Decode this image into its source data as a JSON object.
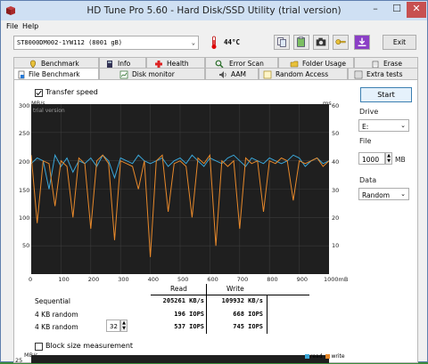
{
  "window": {
    "title": "HD Tune Pro 5.60 - Hard Disk/SSD Utility (trial version)",
    "min": "–",
    "max": "☐",
    "close": "✕"
  },
  "menu": {
    "file": "File",
    "help": "Help"
  },
  "toolbar": {
    "drive": "ST8000DM002-1YW112 (8001 gB)",
    "temperature": "44°C",
    "exit": "Exit"
  },
  "tabs_top": [
    "Benchmark",
    "Info",
    "Health",
    "Error Scan",
    "Folder Usage",
    "Erase"
  ],
  "tabs_bottom": [
    "File Benchmark",
    "Disk monitor",
    "AAM",
    "Random Access",
    "Extra tests"
  ],
  "options": {
    "transfer_speed": "Transfer speed",
    "block_size": "Block size measurement"
  },
  "right": {
    "start": "Start",
    "drive_label": "Drive",
    "drive_value": "E:",
    "file_label": "File",
    "file_value": "1000",
    "file_unit": "MB",
    "data_label": "Data",
    "data_value": "Random"
  },
  "chart_data": {
    "type": "line",
    "title": "",
    "watermark": "trial version",
    "y_left_unit": "MB/s",
    "y_right_unit": "ms",
    "y_left_ticks": [
      300,
      250,
      200,
      150,
      100,
      50
    ],
    "y_right_ticks": [
      60,
      50,
      40,
      30,
      20,
      10
    ],
    "x_unit": "mB",
    "x_ticks": [
      "0",
      "100",
      "200",
      "300",
      "400",
      "500",
      "600",
      "700",
      "800",
      "900",
      "1000mB"
    ],
    "ylim_left": [
      0,
      300
    ],
    "ylim_right": [
      0,
      60
    ],
    "xlim": [
      0,
      1000
    ],
    "grid": true,
    "colors": {
      "read": "#3aa6d8",
      "write": "#e8892b"
    },
    "series": [
      {
        "name": "read",
        "x": [
          0,
          20,
          40,
          60,
          80,
          100,
          120,
          140,
          160,
          180,
          200,
          220,
          240,
          260,
          280,
          300,
          320,
          340,
          360,
          380,
          400,
          420,
          440,
          460,
          480,
          500,
          520,
          540,
          560,
          580,
          600,
          620,
          640,
          660,
          680,
          700,
          720,
          740,
          760,
          780,
          800,
          820,
          840,
          860,
          880,
          900,
          920,
          940,
          960,
          980,
          1000
        ],
        "values": [
          195,
          205,
          200,
          150,
          210,
          190,
          205,
          180,
          200,
          195,
          205,
          190,
          210,
          200,
          170,
          205,
          200,
          195,
          210,
          200,
          195,
          200,
          205,
          190,
          200,
          205,
          195,
          210,
          200,
          190,
          205,
          200,
          195,
          205,
          210,
          200,
          190,
          205,
          200,
          195,
          205,
          200,
          195,
          200,
          210,
          205,
          190,
          200,
          205,
          195,
          200
        ]
      },
      {
        "name": "write",
        "x": [
          0,
          20,
          40,
          60,
          80,
          100,
          120,
          140,
          160,
          180,
          200,
          220,
          240,
          260,
          280,
          300,
          320,
          340,
          360,
          380,
          400,
          420,
          440,
          460,
          480,
          500,
          520,
          540,
          560,
          580,
          600,
          620,
          640,
          660,
          680,
          700,
          720,
          740,
          760,
          780,
          800,
          820,
          840,
          860,
          880,
          900,
          920,
          940,
          960,
          980,
          1000
        ],
        "values": [
          210,
          90,
          200,
          195,
          120,
          200,
          190,
          100,
          205,
          195,
          80,
          200,
          210,
          195,
          60,
          200,
          195,
          190,
          150,
          200,
          30,
          200,
          210,
          110,
          195,
          200,
          190,
          100,
          205,
          195,
          210,
          50,
          200,
          190,
          200,
          80,
          205,
          195,
          200,
          110,
          200,
          195,
          205,
          200,
          130,
          200,
          195,
          200,
          205,
          190,
          200
        ]
      }
    ]
  },
  "results": {
    "header_read": "Read",
    "header_write": "Write",
    "rows": [
      {
        "label": "Sequential",
        "read": "205261 KB/s",
        "write": "109932 KB/s"
      },
      {
        "label": "4 KB random",
        "read": "196 IOPS",
        "write": "668 IOPS"
      },
      {
        "label": "4 KB random",
        "read": "537 IOPS",
        "write": "745 IOPS"
      }
    ],
    "queue_depth": "32"
  },
  "chart2": {
    "y_unit": "MB/s",
    "y_top": "25",
    "legend_read": "read",
    "legend_write": "write"
  }
}
